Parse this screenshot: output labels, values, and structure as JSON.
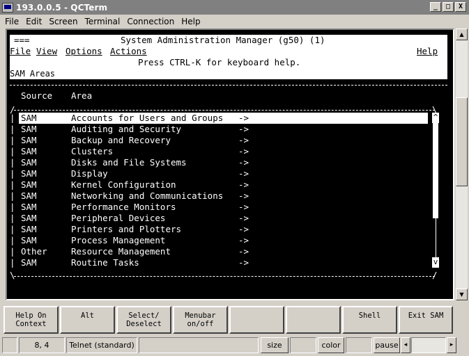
{
  "window": {
    "title": "193.0.0.5 - QCTerm",
    "buttons": [
      "_",
      "□",
      "X"
    ]
  },
  "menubar": {
    "items": [
      "File",
      "Edit",
      "Screen",
      "Terminal",
      "Connection",
      "Help"
    ]
  },
  "terminal": {
    "header_marker": "===",
    "header_title": "System Administration Manager (g50) (1)",
    "sam_menu": {
      "items": [
        "File",
        "View",
        "Options",
        "Actions"
      ],
      "help": "Help"
    },
    "keyboard_help": "Press CTRL-K for keyboard help.",
    "section_title": "SAM Areas",
    "columns": {
      "source": "Source",
      "area": "Area"
    },
    "rows": [
      {
        "source": "SAM",
        "area": "Accounts for Users and Groups",
        "arrow": "->"
      },
      {
        "source": "SAM",
        "area": "Auditing and Security",
        "arrow": "->"
      },
      {
        "source": "SAM",
        "area": "Backup and Recovery",
        "arrow": "->"
      },
      {
        "source": "SAM",
        "area": "Clusters",
        "arrow": "->"
      },
      {
        "source": "SAM",
        "area": "Disks and File Systems",
        "arrow": "->"
      },
      {
        "source": "SAM",
        "area": "Display",
        "arrow": "->"
      },
      {
        "source": "SAM",
        "area": "Kernel Configuration",
        "arrow": "->"
      },
      {
        "source": "SAM",
        "area": "Networking and Communications",
        "arrow": "->"
      },
      {
        "source": "SAM",
        "area": "Performance Monitors",
        "arrow": "->"
      },
      {
        "source": "SAM",
        "area": "Peripheral Devices",
        "arrow": "->"
      },
      {
        "source": "SAM",
        "area": "Printers and Plotters",
        "arrow": "->"
      },
      {
        "source": "SAM",
        "area": "Process Management",
        "arrow": "->"
      },
      {
        "source": "Other",
        "area": "Resource Management",
        "arrow": "->"
      },
      {
        "source": "SAM",
        "area": "Routine Tasks",
        "arrow": "->"
      }
    ],
    "selected_index": 0,
    "scroll_up": "^",
    "scroll_down": "v"
  },
  "function_keys": [
    {
      "label": "Help On\nContext"
    },
    {
      "label": "Alt"
    },
    {
      "label": "Select/\nDeselect"
    },
    {
      "label": "Menubar\non/off"
    },
    {
      "label": ""
    },
    {
      "label": ""
    },
    {
      "label": "Shell"
    },
    {
      "label": "Exit SAM"
    }
  ],
  "statusbar": {
    "cursor_pos": "8, 4",
    "connection": "Telnet (standard)",
    "size_label": "size",
    "color_label": "color",
    "pause_label": "pause",
    "left_arrow": "◂",
    "right_arrow": "▸"
  },
  "colors": {
    "terminal_bg": "#000000",
    "terminal_fg": "#ffffff",
    "chrome": "#d4d0c8",
    "titlebar_inactive": "#808080"
  }
}
